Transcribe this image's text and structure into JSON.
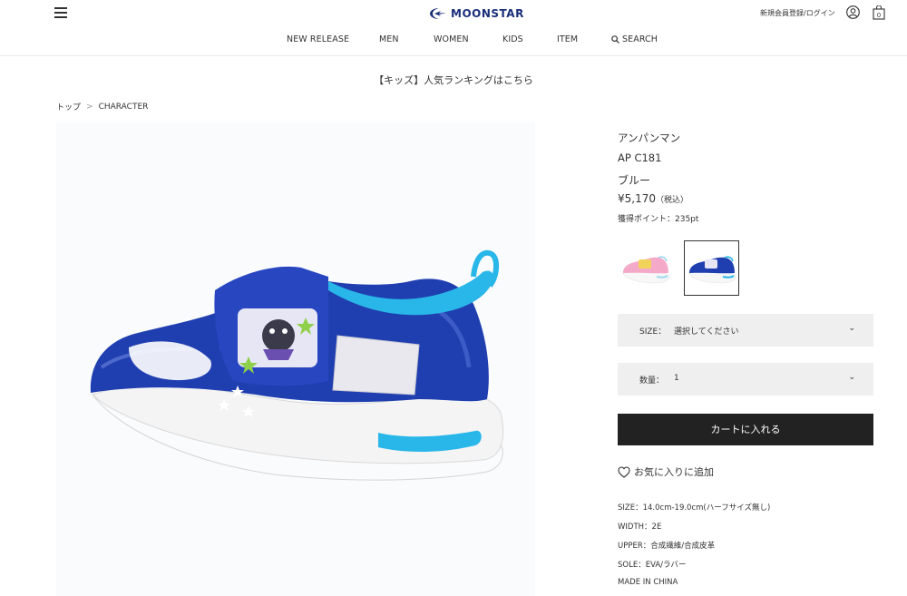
{
  "header": {
    "logo_text": "MOONSTAR",
    "login_label": "新規会員登録/ログイン",
    "menu_icon": "hamburger-icon",
    "user_icon": "user-icon",
    "bag_icon": "bag-icon",
    "bag_count": "0"
  },
  "nav": {
    "items": [
      "NEW RELEASE",
      "MEN",
      "WOMEN",
      "KIDS",
      "ITEM"
    ],
    "search_label": "SEARCH"
  },
  "banner": "【キッズ】人気ランキングはこちら",
  "breadcrumb": {
    "home": "トップ",
    "separator": ">",
    "current": "CHARACTER"
  },
  "product": {
    "brand": "アンパンマン",
    "model": "AP C181",
    "color": "ブルー",
    "price": "¥5,170",
    "tax_note": "（税込）",
    "points": "獲得ポイント：235pt",
    "swatches": [
      {
        "name": "pink",
        "selected": false
      },
      {
        "name": "blue",
        "selected": true
      }
    ],
    "size_label": "SIZE：",
    "size_value": "選択してください",
    "qty_label": "数量：",
    "qty_value": "1",
    "cart_button": "カートに入れる",
    "favorite": "お気に入りに追加",
    "specs": [
      "SIZE：14.0cm-19.0cm(ハーフサイズ無し)",
      "WIDTH：2E",
      "UPPER：合成繊維/合成皮革",
      "SOLE：EVA/ラバー",
      "MADE IN CHINA"
    ]
  },
  "colors": {
    "logo_blue": "#1a2f7a",
    "shoe_blue": "#1f3fb0",
    "accent_cyan": "#29b6e8",
    "button_dark": "#222222",
    "select_bg": "#efefef"
  }
}
